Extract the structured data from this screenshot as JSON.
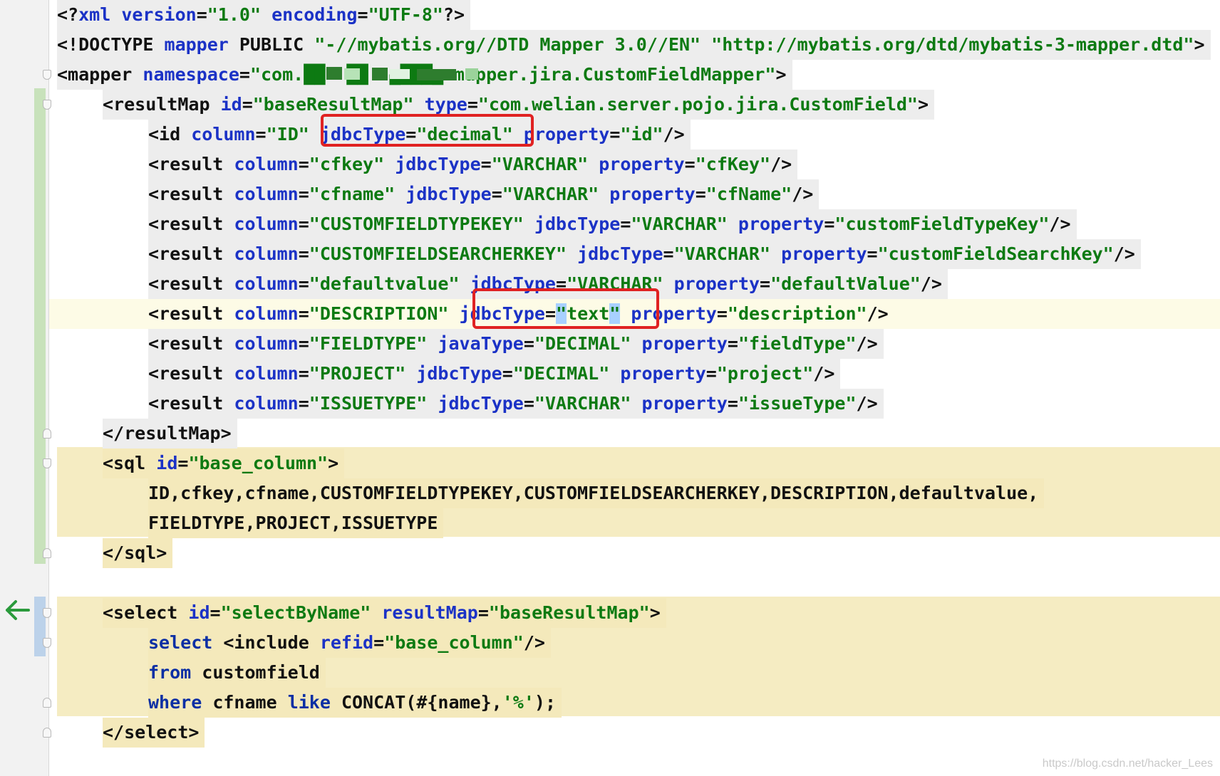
{
  "editor": {
    "language": "xml",
    "lines": [
      {
        "indent": 0,
        "tokens": [
          [
            "t",
            "<?"
          ],
          [
            "a",
            "xml"
          ],
          [
            "t",
            " "
          ],
          [
            "a",
            "version"
          ],
          [
            "t",
            "="
          ],
          [
            "v",
            "\"1.0\""
          ],
          [
            "t",
            " "
          ],
          [
            "a",
            "encoding"
          ],
          [
            "t",
            "="
          ],
          [
            "v",
            "\"UTF-8\""
          ],
          [
            "t",
            "?>"
          ]
        ]
      },
      {
        "indent": 0,
        "tokens": [
          [
            "t",
            "<!DOCTYPE "
          ],
          [
            "a",
            "mapper"
          ],
          [
            "t",
            " PUBLIC "
          ],
          [
            "v",
            "\"-//mybatis.org//DTD Mapper 3.0//EN\""
          ],
          [
            "t",
            " "
          ],
          [
            "v",
            "\"http://mybatis.org/dtd/mybatis-3-mapper.dtd\""
          ],
          [
            "t",
            ">"
          ]
        ]
      },
      {
        "indent": 0,
        "tokens": [
          [
            "t",
            "<mapper "
          ],
          [
            "a",
            "namespace"
          ],
          [
            "t",
            "="
          ],
          [
            "v",
            "\"com.██  ██  ▄███▄ mapper.jira.CustomFieldMapper\""
          ],
          [
            "t",
            ">"
          ]
        ]
      },
      {
        "indent": 1,
        "tokens": [
          [
            "t",
            "<resultMap "
          ],
          [
            "a",
            "id"
          ],
          [
            "t",
            "="
          ],
          [
            "v",
            "\"baseResultMap\""
          ],
          [
            "t",
            " "
          ],
          [
            "a",
            "type"
          ],
          [
            "t",
            "="
          ],
          [
            "v",
            "\"com.welian.server.pojo.jira.CustomField\""
          ],
          [
            "t",
            ">"
          ]
        ]
      },
      {
        "indent": 2,
        "tokens": [
          [
            "t",
            "<id "
          ],
          [
            "a",
            "column"
          ],
          [
            "t",
            "="
          ],
          [
            "v",
            "\"ID\""
          ],
          [
            "t",
            " "
          ],
          [
            "a",
            "jdbcType"
          ],
          [
            "t",
            "="
          ],
          [
            "v",
            "\"decimal\""
          ],
          [
            "t",
            " "
          ],
          [
            "a",
            "property"
          ],
          [
            "t",
            "="
          ],
          [
            "v",
            "\"id\""
          ],
          [
            "t",
            "/>"
          ]
        ]
      },
      {
        "indent": 2,
        "tokens": [
          [
            "t",
            "<result "
          ],
          [
            "a",
            "column"
          ],
          [
            "t",
            "="
          ],
          [
            "v",
            "\"cfkey\""
          ],
          [
            "t",
            " "
          ],
          [
            "a",
            "jdbcType"
          ],
          [
            "t",
            "="
          ],
          [
            "v",
            "\"VARCHAR\""
          ],
          [
            "t",
            " "
          ],
          [
            "a",
            "property"
          ],
          [
            "t",
            "="
          ],
          [
            "v",
            "\"cfKey\""
          ],
          [
            "t",
            "/>"
          ]
        ]
      },
      {
        "indent": 2,
        "tokens": [
          [
            "t",
            "<result "
          ],
          [
            "a",
            "column"
          ],
          [
            "t",
            "="
          ],
          [
            "v",
            "\"cfname\""
          ],
          [
            "t",
            " "
          ],
          [
            "a",
            "jdbcType"
          ],
          [
            "t",
            "="
          ],
          [
            "v",
            "\"VARCHAR\""
          ],
          [
            "t",
            " "
          ],
          [
            "a",
            "property"
          ],
          [
            "t",
            "="
          ],
          [
            "v",
            "\"cfName\""
          ],
          [
            "t",
            "/>"
          ]
        ]
      },
      {
        "indent": 2,
        "tokens": [
          [
            "t",
            "<result "
          ],
          [
            "a",
            "column"
          ],
          [
            "t",
            "="
          ],
          [
            "v",
            "\"CUSTOMFIELDTYPEKEY\""
          ],
          [
            "t",
            " "
          ],
          [
            "a",
            "jdbcType"
          ],
          [
            "t",
            "="
          ],
          [
            "v",
            "\"VARCHAR\""
          ],
          [
            "t",
            " "
          ],
          [
            "a",
            "property"
          ],
          [
            "t",
            "="
          ],
          [
            "v",
            "\"customFieldTypeKey\""
          ],
          [
            "t",
            "/>"
          ]
        ]
      },
      {
        "indent": 2,
        "tokens": [
          [
            "t",
            "<result "
          ],
          [
            "a",
            "column"
          ],
          [
            "t",
            "="
          ],
          [
            "v",
            "\"CUSTOMFIELDSEARCHERKEY\""
          ],
          [
            "t",
            " "
          ],
          [
            "a",
            "jdbcType"
          ],
          [
            "t",
            "="
          ],
          [
            "v",
            "\"VARCHAR\""
          ],
          [
            "t",
            " "
          ],
          [
            "a",
            "property"
          ],
          [
            "t",
            "="
          ],
          [
            "v",
            "\"customFieldSearchKey\""
          ],
          [
            "t",
            "/>"
          ]
        ]
      },
      {
        "indent": 2,
        "tokens": [
          [
            "t",
            "<result "
          ],
          [
            "a",
            "column"
          ],
          [
            "t",
            "="
          ],
          [
            "v",
            "\"defaultvalue\""
          ],
          [
            "t",
            " "
          ],
          [
            "a",
            "jdbcType"
          ],
          [
            "t",
            "="
          ],
          [
            "v",
            "\"VARCHAR\""
          ],
          [
            "t",
            " "
          ],
          [
            "a",
            "property"
          ],
          [
            "t",
            "="
          ],
          [
            "v",
            "\"defaultValue\""
          ],
          [
            "t",
            "/>"
          ]
        ]
      },
      {
        "indent": 2,
        "caret": true,
        "tokens": [
          [
            "t",
            "<result "
          ],
          [
            "a",
            "column"
          ],
          [
            "t",
            "="
          ],
          [
            "v",
            "\"DESCRIPTION\""
          ],
          [
            "t",
            " "
          ],
          [
            "a",
            "jdbcType"
          ],
          [
            "t",
            "="
          ],
          [
            "vs",
            "\""
          ],
          [
            "v",
            "text"
          ],
          [
            "vs",
            "\""
          ],
          [
            "t",
            " "
          ],
          [
            "a",
            "property"
          ],
          [
            "t",
            "="
          ],
          [
            "v",
            "\"description\""
          ],
          [
            "t",
            "/>"
          ]
        ]
      },
      {
        "indent": 2,
        "tokens": [
          [
            "t",
            "<result "
          ],
          [
            "a",
            "column"
          ],
          [
            "t",
            "="
          ],
          [
            "v",
            "\"FIELDTYPE\""
          ],
          [
            "t",
            " "
          ],
          [
            "a",
            "javaType"
          ],
          [
            "t",
            "="
          ],
          [
            "v",
            "\"DECIMAL\""
          ],
          [
            "t",
            " "
          ],
          [
            "a",
            "property"
          ],
          [
            "t",
            "="
          ],
          [
            "v",
            "\"fieldType\""
          ],
          [
            "t",
            "/>"
          ]
        ]
      },
      {
        "indent": 2,
        "tokens": [
          [
            "t",
            "<result "
          ],
          [
            "a",
            "column"
          ],
          [
            "t",
            "="
          ],
          [
            "v",
            "\"PROJECT\""
          ],
          [
            "t",
            " "
          ],
          [
            "a",
            "jdbcType"
          ],
          [
            "t",
            "="
          ],
          [
            "v",
            "\"DECIMAL\""
          ],
          [
            "t",
            " "
          ],
          [
            "a",
            "property"
          ],
          [
            "t",
            "="
          ],
          [
            "v",
            "\"project\""
          ],
          [
            "t",
            "/>"
          ]
        ]
      },
      {
        "indent": 2,
        "tokens": [
          [
            "t",
            "<result "
          ],
          [
            "a",
            "column"
          ],
          [
            "t",
            "="
          ],
          [
            "v",
            "\"ISSUETYPE\""
          ],
          [
            "t",
            " "
          ],
          [
            "a",
            "jdbcType"
          ],
          [
            "t",
            "="
          ],
          [
            "v",
            "\"VARCHAR\""
          ],
          [
            "t",
            " "
          ],
          [
            "a",
            "property"
          ],
          [
            "t",
            "="
          ],
          [
            "v",
            "\"issueType\""
          ],
          [
            "t",
            "/>"
          ]
        ]
      },
      {
        "indent": 1,
        "tokens": [
          [
            "t",
            "</resultMap>"
          ]
        ]
      },
      {
        "indent": 1,
        "sql": true,
        "tokens": [
          [
            "t",
            "<sql "
          ],
          [
            "a",
            "id"
          ],
          [
            "t",
            "="
          ],
          [
            "v",
            "\"base_column\""
          ],
          [
            "t",
            ">"
          ]
        ]
      },
      {
        "indent": 2,
        "sql": true,
        "tokens": [
          [
            "t",
            "ID,cfkey,cfname,CUSTOMFIELDTYPEKEY,CUSTOMFIELDSEARCHERKEY,DESCRIPTION,defaultvalue,"
          ]
        ]
      },
      {
        "indent": 2,
        "sql": true,
        "tokens": [
          [
            "t",
            "FIELDTYPE,PROJECT,ISSUETYPE"
          ]
        ]
      },
      {
        "indent": 1,
        "sql": true,
        "tokens": [
          [
            "t",
            "</sql>"
          ]
        ]
      },
      {
        "indent": 0,
        "tokens": []
      },
      {
        "indent": 1,
        "sql": true,
        "tokens": [
          [
            "t",
            "<select "
          ],
          [
            "a",
            "id"
          ],
          [
            "t",
            "="
          ],
          [
            "v",
            "\"selectByName\""
          ],
          [
            "t",
            " "
          ],
          [
            "a",
            "resultMap"
          ],
          [
            "t",
            "="
          ],
          [
            "v",
            "\"baseResultMap\""
          ],
          [
            "t",
            ">"
          ]
        ]
      },
      {
        "indent": 2,
        "sql": true,
        "tokens": [
          [
            "k",
            "select"
          ],
          [
            "t",
            " <include "
          ],
          [
            "a",
            "refid"
          ],
          [
            "t",
            "="
          ],
          [
            "v",
            "\"base_column\""
          ],
          [
            "t",
            "/>"
          ]
        ]
      },
      {
        "indent": 2,
        "sql": true,
        "tokens": [
          [
            "k",
            "from"
          ],
          [
            "t",
            " customfield"
          ]
        ]
      },
      {
        "indent": 2,
        "sql": true,
        "tokens": [
          [
            "k",
            "where"
          ],
          [
            "t",
            " cfname "
          ],
          [
            "k",
            "like"
          ],
          [
            "t",
            " CONCAT(#{name},"
          ],
          [
            "q",
            "'%'"
          ],
          [
            "t",
            ");"
          ]
        ]
      },
      {
        "indent": 1,
        "sql": true,
        "tokens": [
          [
            "t",
            "</select>"
          ]
        ]
      }
    ]
  },
  "watermark": "https://blog.csdn.net/hacker_Lees",
  "colors": {
    "tag": "#111111",
    "attribute": "#1b32c6",
    "value": "#0d7a12",
    "keyword": "#0b2fa4",
    "highlight_box": "#e02222",
    "sql_injection_bg": "#f5ecc2",
    "vcs_added": "#c6dfb8",
    "vcs_modified": "#b9cfe6"
  },
  "icons": [
    "fold-icon",
    "navigate-back-arrow-icon"
  ]
}
